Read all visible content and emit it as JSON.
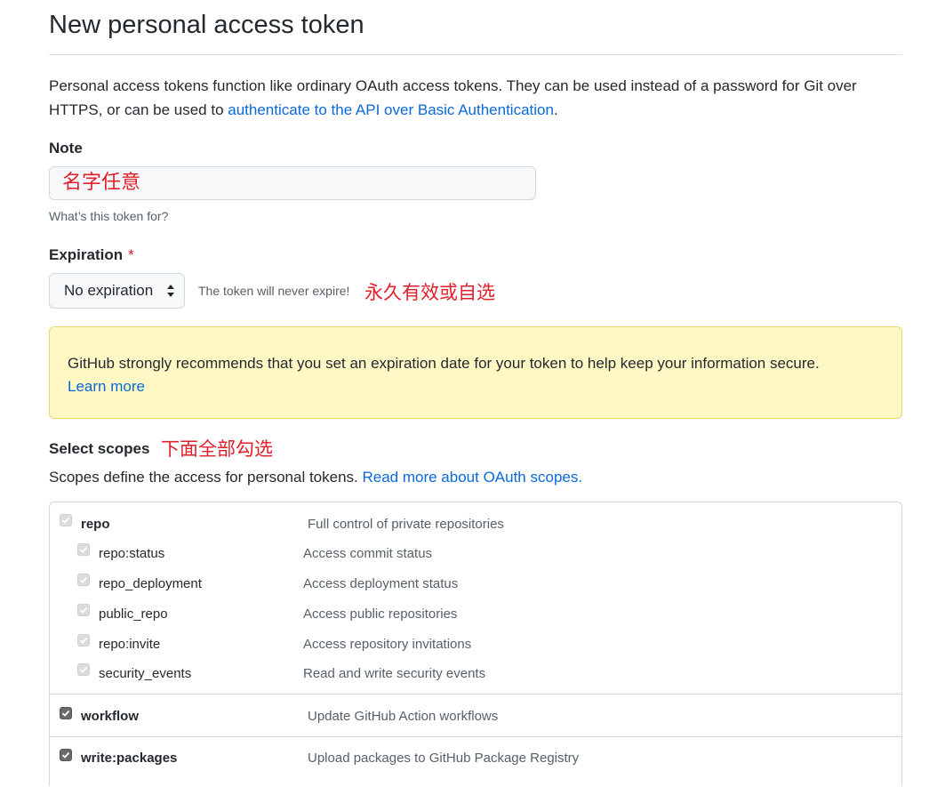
{
  "page": {
    "title": "New personal access token",
    "intro_text": "Personal access tokens function like ordinary OAuth access tokens. They can be used instead of a password for Git over HTTPS, or can be used to ",
    "intro_link": "authenticate to the API over Basic Authentication",
    "intro_end": "."
  },
  "note": {
    "label": "Note",
    "value": "名字任意",
    "hint": "What’s this token for?"
  },
  "expiration": {
    "label": "Expiration",
    "required_mark": "*",
    "selected": "No expiration",
    "info": "The token will never expire!",
    "annotation": "永久有效或自选"
  },
  "flash": {
    "text": "GitHub strongly recommends that you set an expiration date for your token to help keep your information secure.",
    "link": "Learn more"
  },
  "scopes": {
    "label": "Select scopes",
    "annotation": "下面全部勾选",
    "description": "Scopes define the access for personal tokens. ",
    "description_link": "Read more about OAuth scopes.",
    "items": [
      {
        "name": "repo",
        "desc": "Full control of private repositories",
        "state": "disabled"
      },
      {
        "name": "repo:status",
        "desc": "Access commit status",
        "state": "disabled"
      },
      {
        "name": "repo_deployment",
        "desc": "Access deployment status",
        "state": "disabled"
      },
      {
        "name": "public_repo",
        "desc": "Access public repositories",
        "state": "disabled"
      },
      {
        "name": "repo:invite",
        "desc": "Access repository invitations",
        "state": "disabled"
      },
      {
        "name": "security_events",
        "desc": "Read and write security events",
        "state": "disabled"
      },
      {
        "name": "workflow",
        "desc": "Update GitHub Action workflows",
        "state": "checked"
      },
      {
        "name": "write:packages",
        "desc": "Upload packages to GitHub Package Registry",
        "state": "checked"
      }
    ]
  },
  "colors": {
    "link": "#0969da",
    "annotation": "#e0202a",
    "flash_bg": "#fff8c5",
    "flash_border": "#e9d571"
  }
}
